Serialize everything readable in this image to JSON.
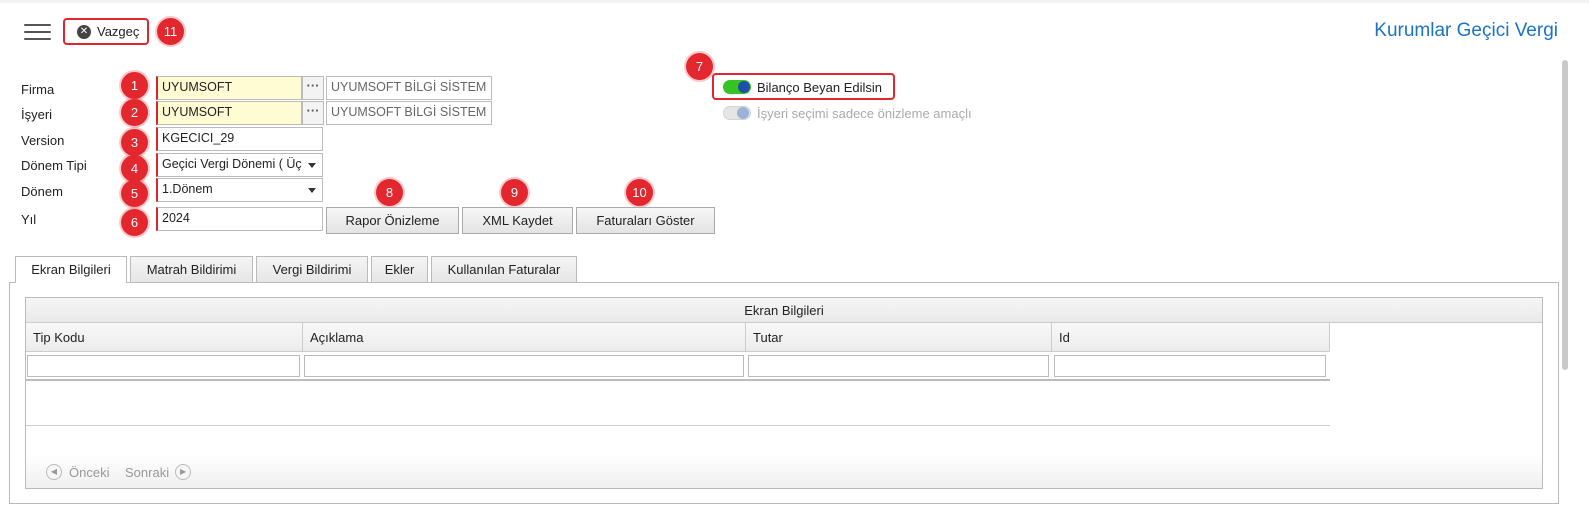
{
  "header": {
    "cancel_label": "Vazgeç",
    "page_title": "Kurumlar Geçici Vergi",
    "cancel_badge": "11"
  },
  "form": {
    "firma": {
      "label": "Firma",
      "badge": "1",
      "code": "UYUMSOFT",
      "name": "UYUMSOFT BİLGİ SİSTEM"
    },
    "isyeri": {
      "label": "İşyeri",
      "badge": "2",
      "code": "UYUMSOFT",
      "name": "UYUMSOFT BİLGİ SİSTEM"
    },
    "version": {
      "label": "Version",
      "badge": "3",
      "value": "KGECICI_29"
    },
    "donem_tipi": {
      "label": "Dönem Tipi",
      "badge": "4",
      "value": "Geçici Vergi Dönemi ( Üç"
    },
    "donem": {
      "label": "Dönem",
      "badge": "5",
      "value": "1.Dönem"
    },
    "yil": {
      "label": "Yıl",
      "badge": "6",
      "value": "2024"
    }
  },
  "toggles": {
    "bilanco": {
      "label": "Bilanço Beyan Edilsin",
      "badge": "7",
      "on": true,
      "color": "#35c425"
    },
    "isyeri_onizleme": {
      "label": "İşyeri seçimi sadece önizleme amaçlı",
      "on": false
    }
  },
  "actions": [
    {
      "label": "Rapor Önizleme",
      "badge": "8"
    },
    {
      "label": "XML Kaydet",
      "badge": "9"
    },
    {
      "label": "Faturaları Göster",
      "badge": "10"
    }
  ],
  "tabs": [
    "Ekran Bilgileri",
    "Matrah Bildirimi",
    "Vergi Bildirimi",
    "Ekler",
    "Kullanılan Faturalar"
  ],
  "grid": {
    "caption": "Ekran Bilgileri",
    "columns": [
      "Tip Kodu",
      "Açıklama",
      "Tutar",
      "Id"
    ],
    "pager": {
      "prev": "Önceki",
      "next": "Sonraki"
    }
  },
  "colors": {
    "accent": "#1a73c7",
    "badge": "#e3272e",
    "required": "#d9252c"
  }
}
